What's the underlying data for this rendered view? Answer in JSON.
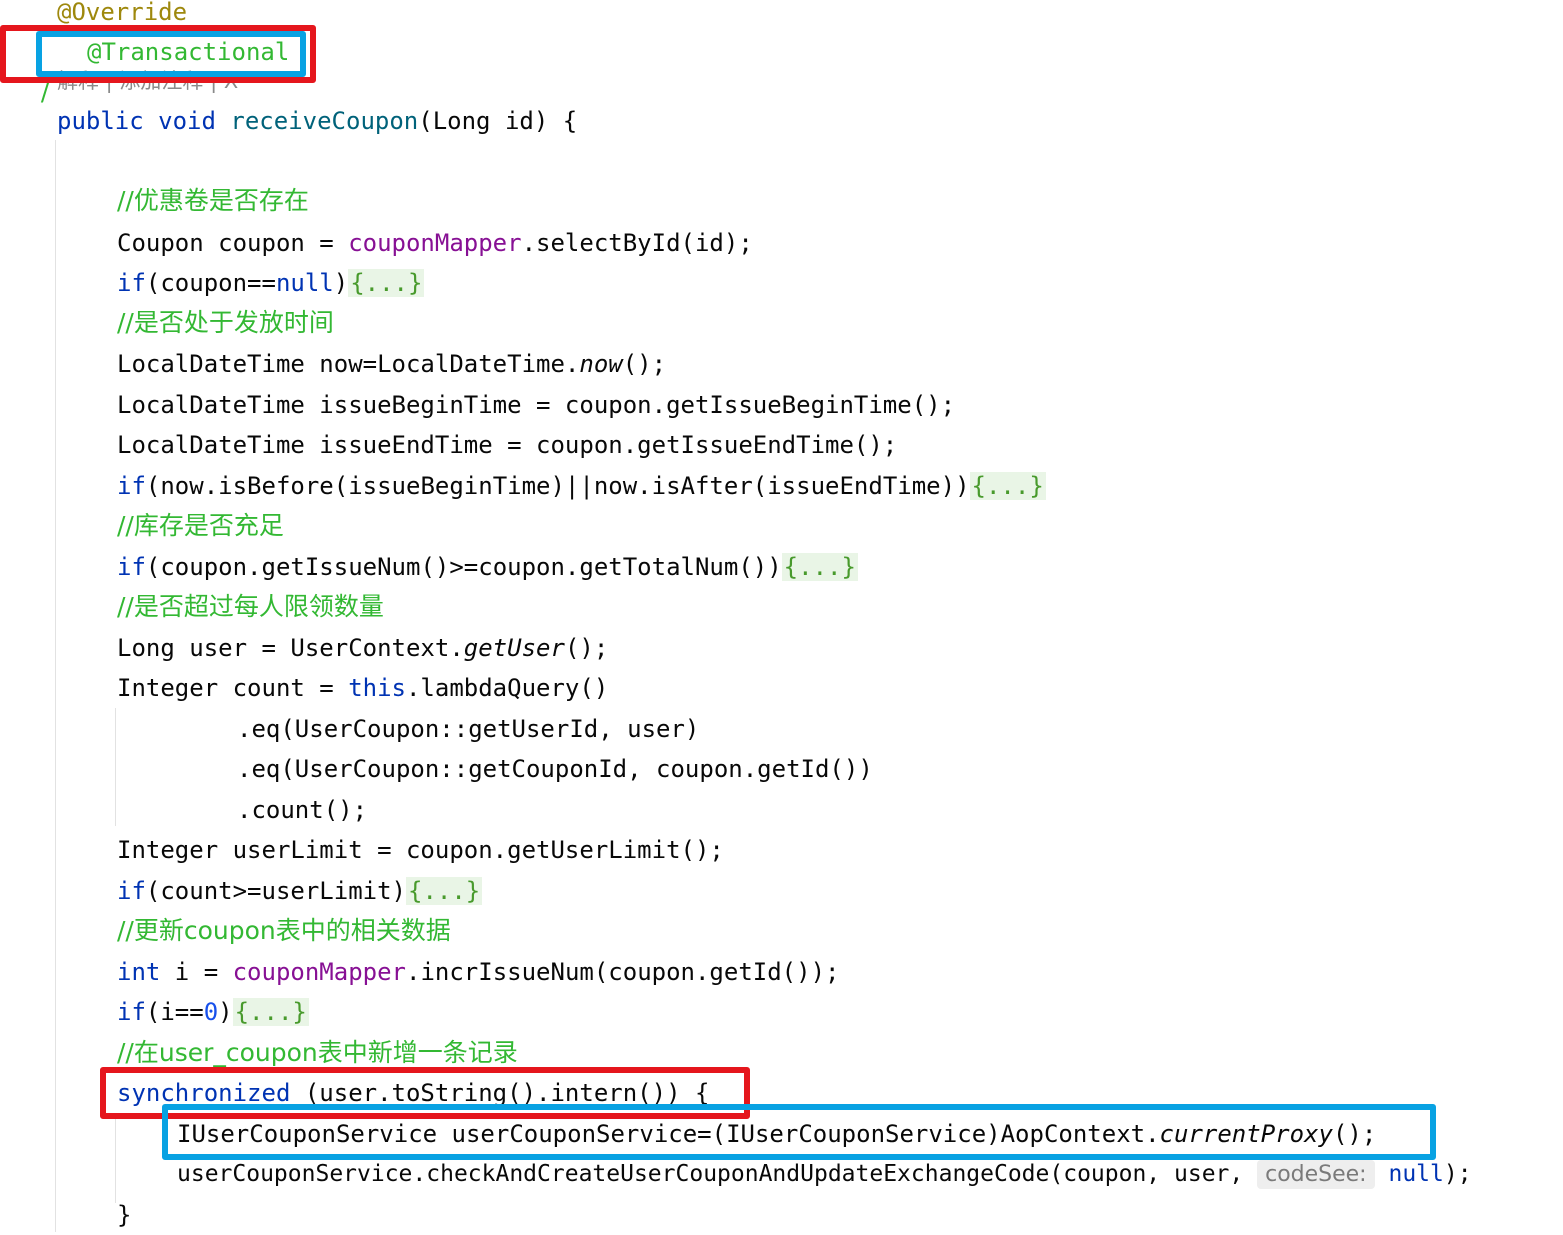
{
  "editor": {
    "annotation_override": "@Override",
    "line_comment_marker": "/",
    "annotation_transactional": "@Transactional",
    "codelens": "解释 | 添加注释 | X",
    "method": {
      "kw_public": "public",
      "kw_void": "void",
      "name": "receiveCoupon",
      "params": "(Long id) {"
    },
    "comments": {
      "c1": "//优惠卷是否存在",
      "c2": "//是否处于发放时间",
      "c3": "//库存是否充足",
      "c4": "//是否超过每人限领数量",
      "c5": "//更新coupon表中的相关数据",
      "c6": "//在user_coupon表中新增一条记录"
    },
    "lines": {
      "l_coupon_a": "Coupon coupon = ",
      "l_coupon_field": "couponMapper",
      "l_coupon_b": ".selectById(id);",
      "l_if1_kw": "if",
      "l_if1_a": "(coupon==",
      "l_if1_null": "null",
      "l_if1_b": ")",
      "fold": "{...}",
      "l_now_a": "LocalDateTime now=LocalDateTime.",
      "l_now_it": "now",
      "l_now_b": "();",
      "l_begin": "LocalDateTime issueBeginTime = coupon.getIssueBeginTime();",
      "l_end": "LocalDateTime issueEndTime = coupon.getIssueEndTime();",
      "l_if2_kw": "if",
      "l_if2_a": "(now.isBefore(issueBeginTime)||now.isAfter(issueEndTime))",
      "l_if3_kw": "if",
      "l_if3_a": "(coupon.getIssueNum()>=coupon.getTotalNum())",
      "l_user_a": "Long user = UserContext.",
      "l_user_it": "getUser",
      "l_user_b": "();",
      "l_count_a": "Integer count = ",
      "l_count_this": "this",
      "l_count_b": ".lambdaQuery()",
      "l_eq1": ".eq(UserCoupon::getUserId, user)",
      "l_eq2": ".eq(UserCoupon::getCouponId, coupon.getId())",
      "l_cnt": ".count();",
      "l_limit": "Integer userLimit = coupon.getUserLimit();",
      "l_if4_kw": "if",
      "l_if4_a": "(count>=userLimit)",
      "l_int_kw": "int",
      "l_int_a": " i = ",
      "l_int_field": "couponMapper",
      "l_int_b": ".incrIssueNum(coupon.getId());",
      "l_if5_kw": "if",
      "l_if5_a": "(i==",
      "l_if5_num": "0",
      "l_if5_b": ")",
      "l_sync_kw": "synchronized",
      "l_sync_a": " (user.toString().intern()) {",
      "l_proxy_a": "IUserCouponService userCouponService=(IUserCouponService)AopContext.",
      "l_proxy_it": "currentProxy",
      "l_proxy_b": "();",
      "l_call_a": "userCouponService.checkAndCreateUserCouponAndUpdateExchangeCode(coupon, user, ",
      "l_call_hint": "codeSee:",
      "l_call_null": "null",
      "l_call_b": ");",
      "l_close": "}"
    }
  },
  "highlight_colors": {
    "red": "#e5161d",
    "blue": "#08a2e3"
  }
}
